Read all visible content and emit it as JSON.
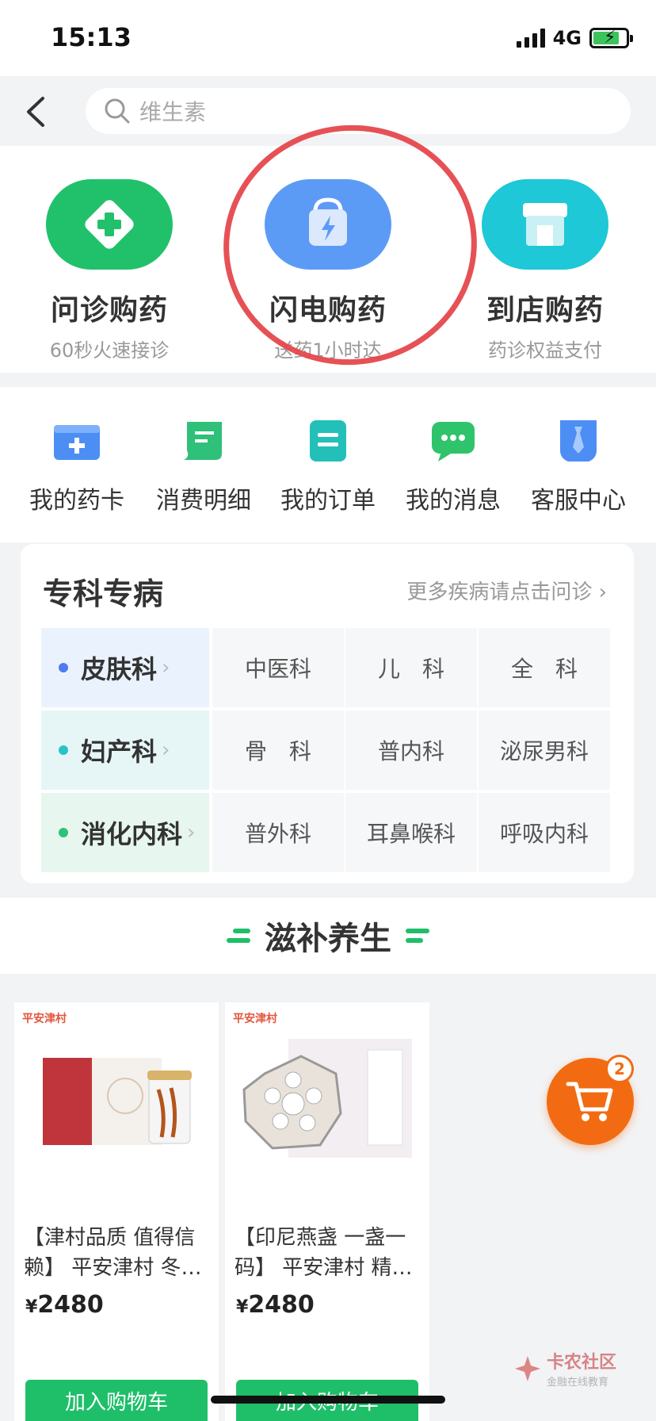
{
  "status_bar": {
    "time": "15:13",
    "network": "4G"
  },
  "search": {
    "placeholder": "维生素"
  },
  "services": [
    {
      "title": "问诊购药",
      "subtitle": "60秒火速接诊",
      "color": "#21c16b",
      "icon": "medical-cross-icon"
    },
    {
      "title": "闪电购药",
      "subtitle": "送药1小时达",
      "color": "#5b9bf5",
      "icon": "lightning-bag-icon"
    },
    {
      "title": "到店购药",
      "subtitle": "药诊权益支付",
      "color": "#1ec8d6",
      "icon": "store-icon"
    }
  ],
  "quick_links": [
    {
      "label": "我的药卡",
      "icon": "medicine-card-icon",
      "color": "#4d8ef5"
    },
    {
      "label": "消费明细",
      "icon": "receipt-icon",
      "color": "#2fc07a"
    },
    {
      "label": "我的订单",
      "icon": "order-icon",
      "color": "#22c0b8"
    },
    {
      "label": "我的消息",
      "icon": "message-icon",
      "color": "#2fc36b"
    },
    {
      "label": "客服中心",
      "icon": "service-tie-icon",
      "color": "#4d8ef5"
    }
  ],
  "specialty": {
    "title": "专科专病",
    "more": "更多疾病请点击问诊",
    "rows": [
      {
        "main": "皮肤科",
        "dot_color": "#4d7bf0",
        "bg": "#eaf3fd",
        "cells": [
          "中医科",
          "儿　科",
          "全　科"
        ]
      },
      {
        "main": "妇产科",
        "dot_color": "#28c3c9",
        "bg": "#e6f6f6",
        "cells": [
          "骨　科",
          "普内科",
          "泌尿男科"
        ]
      },
      {
        "main": "消化内科",
        "dot_color": "#2fc07a",
        "bg": "#e7f6ee",
        "cells": [
          "普外科",
          "耳鼻喉科",
          "呼吸内科"
        ]
      }
    ]
  },
  "section": {
    "title": "滋补养生"
  },
  "products": [
    {
      "brand": "平安津村",
      "name": "【津村品质 值得信赖】 平安津村 冬…",
      "currency": "¥",
      "price": "2480",
      "button": "加入购物车"
    },
    {
      "brand": "平安津村",
      "name": "【印尼燕盏 一盏一码】 平安津村 精…",
      "currency": "¥",
      "price": "2480",
      "button": "加入购物车"
    }
  ],
  "cart": {
    "count": "2"
  },
  "watermark": {
    "title": "卡农社区",
    "subtitle": "金融在线教育"
  },
  "colors": {
    "brand_green": "#1fbf6a",
    "cart_orange": "#f26b12",
    "annotation_red": "#e5484d"
  }
}
